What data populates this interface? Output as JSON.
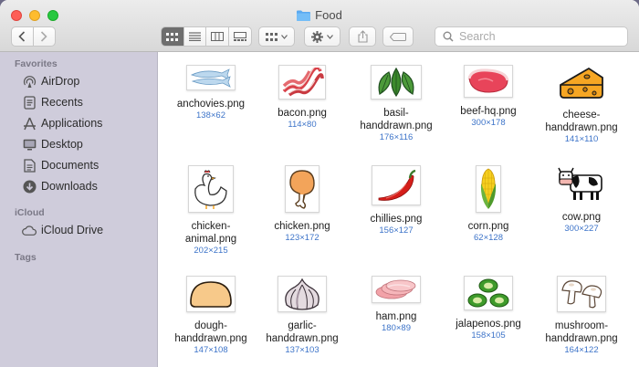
{
  "window": {
    "title": "Food"
  },
  "toolbar": {
    "search_placeholder": "Search"
  },
  "sidebar": {
    "favorites_label": "Favorites",
    "favorites": [
      {
        "label": "AirDrop",
        "icon": "airdrop-icon"
      },
      {
        "label": "Recents",
        "icon": "recents-icon"
      },
      {
        "label": "Applications",
        "icon": "applications-icon"
      },
      {
        "label": "Desktop",
        "icon": "desktop-icon"
      },
      {
        "label": "Documents",
        "icon": "documents-icon"
      },
      {
        "label": "Downloads",
        "icon": "downloads-icon"
      }
    ],
    "icloud_label": "iCloud",
    "icloud": [
      {
        "label": "iCloud Drive",
        "icon": "cloud-icon"
      }
    ],
    "tags_label": "Tags"
  },
  "files": [
    {
      "name": "anchovies.png",
      "dims": "138×62",
      "icon": "anchovies-icon"
    },
    {
      "name": "bacon.png",
      "dims": "114×80",
      "icon": "bacon-icon"
    },
    {
      "name": "basil-\nhanddrawn.png",
      "dims": "176×116",
      "icon": "basil-icon"
    },
    {
      "name": "beef-hq.png",
      "dims": "300×178",
      "icon": "beef-icon"
    },
    {
      "name": "cheese-\nhanddrawn.png",
      "dims": "141×110",
      "icon": "cheese-icon"
    },
    {
      "name": "chicken-\nanimal.png",
      "dims": "202×215",
      "icon": "chicken-animal-icon"
    },
    {
      "name": "chicken.png",
      "dims": "123×172",
      "icon": "chicken-leg-icon"
    },
    {
      "name": "chillies.png",
      "dims": "156×127",
      "icon": "chilli-icon"
    },
    {
      "name": "corn.png",
      "dims": "62×128",
      "icon": "corn-icon"
    },
    {
      "name": "cow.png",
      "dims": "300×227",
      "icon": "cow-icon"
    },
    {
      "name": "dough-\nhanddrawn.png",
      "dims": "147×108",
      "icon": "dough-icon"
    },
    {
      "name": "garlic-\nhanddrawn.png",
      "dims": "137×103",
      "icon": "garlic-icon"
    },
    {
      "name": "ham.png",
      "dims": "180×89",
      "icon": "ham-icon"
    },
    {
      "name": "jalapenos.png",
      "dims": "158×105",
      "icon": "jalapeno-icon"
    },
    {
      "name": "mushroom-\nhanddrawn.png",
      "dims": "164×122",
      "icon": "mushroom-icon"
    }
  ]
}
